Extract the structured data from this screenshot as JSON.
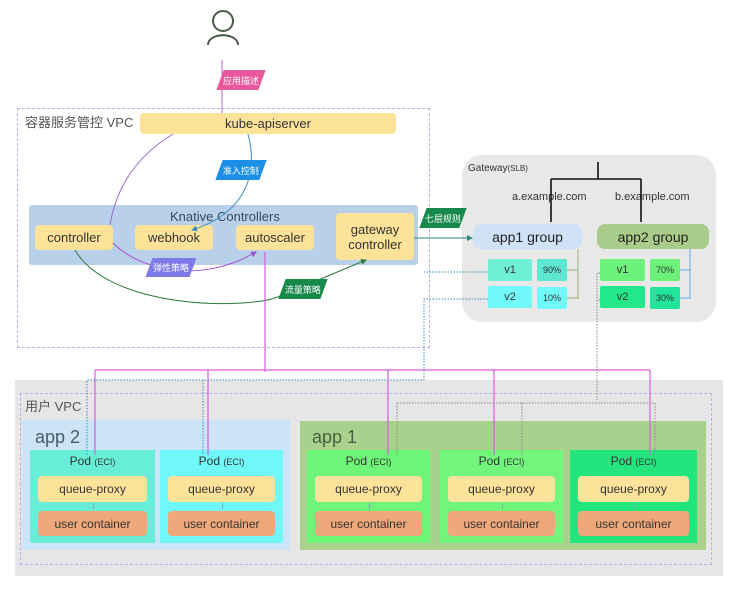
{
  "user_label": "",
  "tags": {
    "app_desc": "应用描述",
    "admission": "准入控制",
    "elastic": "弹性策略",
    "traffic": "流量策略",
    "l7_rules": "七层规则"
  },
  "control_vpc": {
    "label": "容器服务管控 VPC",
    "apiserver": "kube-apiserver",
    "knative": {
      "title": "Knative Controllers",
      "controller": "controller",
      "webhook": "webhook",
      "autoscaler": "autoscaler",
      "gateway_controller": "gateway controller"
    }
  },
  "gateway": {
    "label": "Gateway",
    "label_suffix": "(SLB)",
    "host_a": "a.example.com",
    "host_b": "b.example.com",
    "app1_group": {
      "name": "app1 group",
      "v1": "v1",
      "v1_pct": "90%",
      "v2": "v2",
      "v2_pct": "10%"
    },
    "app2_group": {
      "name": "app2 group",
      "v1": "v1",
      "v1_pct": "70%",
      "v2": "v2",
      "v2_pct": "30%"
    }
  },
  "user_vpc": {
    "label": "用户 VPC",
    "app2": "app 2",
    "app1": "app 1",
    "pod": "Pod",
    "pod_suffix": "(ECI)",
    "queue_proxy": "queue-proxy",
    "user_container": "user container"
  },
  "colors": {
    "yellow": "#fde29a",
    "knative_bg": "#b8d0ea",
    "container": "#f0a87a",
    "pink_line": "#d95be0",
    "tag_pink": "#e9579c",
    "tag_blue": "#1c8fe6",
    "tag_purple": "#7e7ae8",
    "tag_green": "#17894a"
  }
}
